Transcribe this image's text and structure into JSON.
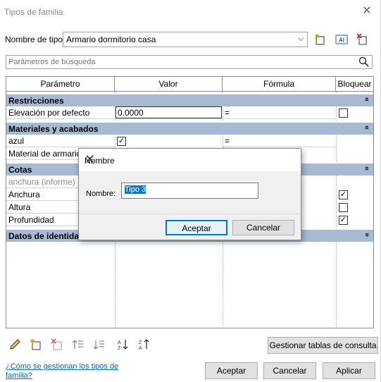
{
  "window": {
    "title": "Tipos de familia"
  },
  "type_row": {
    "label": "Nombre de tipo:",
    "value": "Armario dormitorio casa"
  },
  "search": {
    "placeholder": "Parámetros de búsqueda"
  },
  "table": {
    "headers": [
      "Parámetro",
      "Valor",
      "Fórmula",
      "Bloquear"
    ],
    "groups": {
      "restricciones": "Restricciones",
      "materiales": "Materiales y acabados",
      "cotas": "Cotas",
      "identidad": "Datos de identidad"
    },
    "rows": {
      "elevacion": {
        "param": "Elevación por defecto",
        "value": "0.0000",
        "formula": "="
      },
      "azul": {
        "param": "azul",
        "formula": "="
      },
      "material_armario": {
        "param": "Material de armario"
      },
      "anchura_informe": {
        "param": "anchura (informe)"
      },
      "anchura": {
        "param": "Anchura"
      },
      "altura": {
        "param": "Altura"
      },
      "profundidad": {
        "param": "Profundidad"
      }
    },
    "collapse_up": "»",
    "check": "✓"
  },
  "bottom": {
    "manage_lookup": "Gestionar tablas de consulta",
    "help_link": "¿Cómo se gestionan los tipos de familia?",
    "ok": "Aceptar",
    "cancel": "Cancelar",
    "apply": "Aplicar"
  },
  "dialog": {
    "title": "Nombre",
    "label": "Nombre:",
    "value": "Tipo 3",
    "ok": "Aceptar",
    "cancel": "Cancelar"
  },
  "colors": {
    "group_header": "#a7b9d3",
    "link": "#0066cc",
    "selection": "#0078d7"
  }
}
